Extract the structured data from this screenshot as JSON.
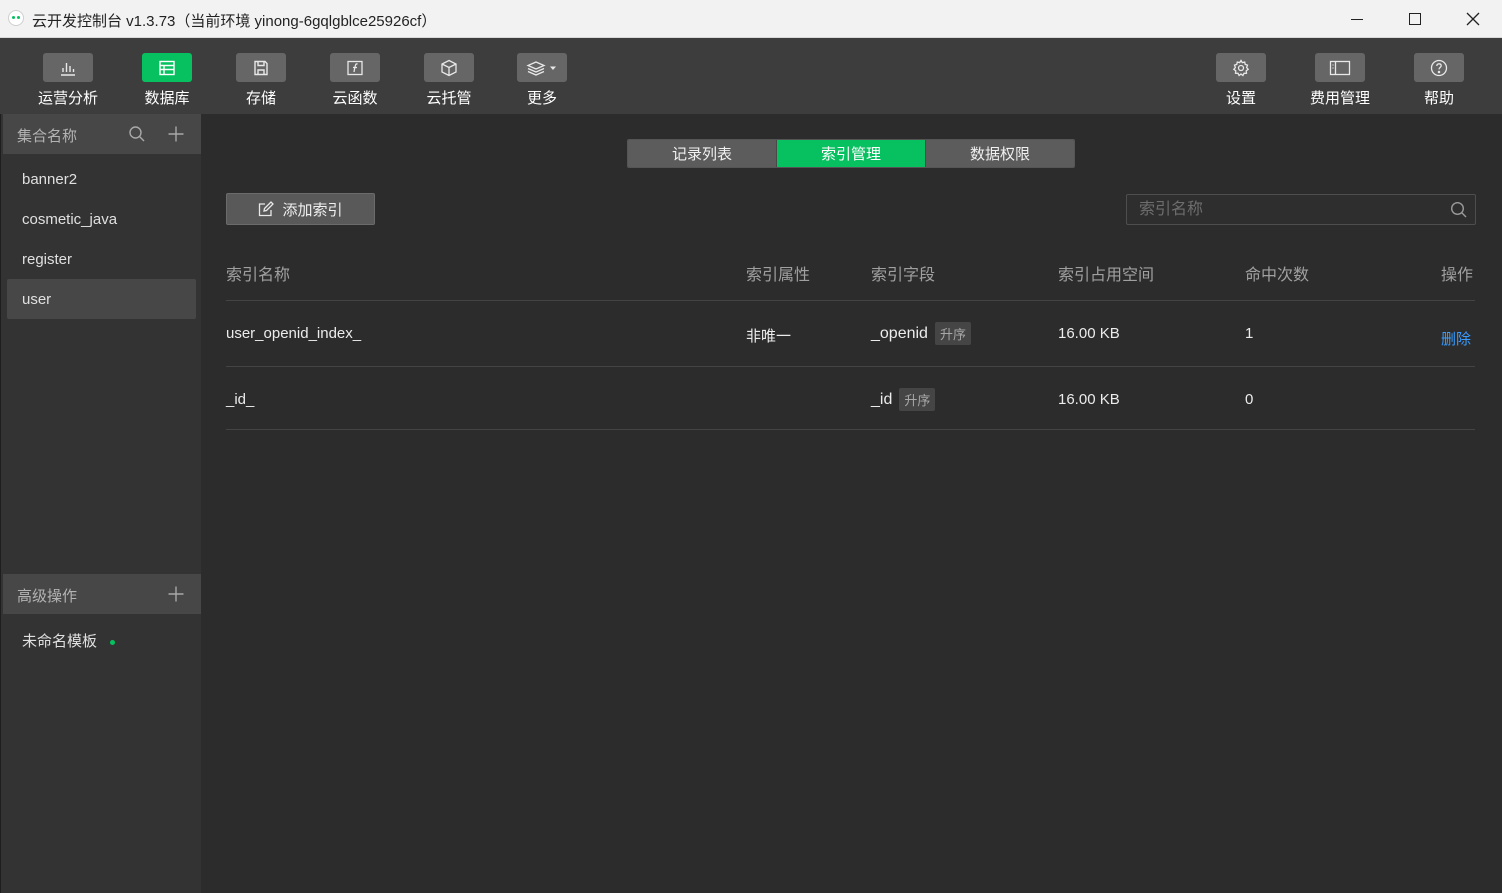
{
  "titlebar": {
    "title": "云开发控制台 v1.3.73（当前环境 yinong-6gqlgblce25926cf）"
  },
  "toolbar": {
    "left": [
      {
        "label": "运营分析",
        "icon": "bar-chart-icon"
      },
      {
        "label": "数据库",
        "icon": "database-icon",
        "active": true
      },
      {
        "label": "存储",
        "icon": "save-icon"
      },
      {
        "label": "云函数",
        "icon": "function-icon"
      },
      {
        "label": "云托管",
        "icon": "box-icon"
      },
      {
        "label": "更多",
        "icon": "layers-dropdown-icon"
      }
    ],
    "right": [
      {
        "label": "设置",
        "icon": "gear-icon"
      },
      {
        "label": "费用管理",
        "icon": "billing-icon"
      },
      {
        "label": "帮助",
        "icon": "help-icon"
      }
    ]
  },
  "sidebar": {
    "collections_header": "集合名称",
    "collections": [
      "banner2",
      "cosmetic_java",
      "register",
      "user"
    ],
    "active_collection": "user",
    "advanced_header": "高级操作",
    "templates": [
      "未命名模板"
    ]
  },
  "main": {
    "tabs": [
      "记录列表",
      "索引管理",
      "数据权限"
    ],
    "active_tab": "索引管理",
    "add_button": "添加索引",
    "search_placeholder": "索引名称",
    "columns": [
      "索引名称",
      "索引属性",
      "索引字段",
      "索引占用空间",
      "命中次数",
      "操作"
    ],
    "rows": [
      {
        "name": "user_openid_index_",
        "attribute": "非唯一",
        "field": "_openid",
        "order": "升序",
        "size": "16.00 KB",
        "hits": "1",
        "action": "删除"
      },
      {
        "name": "_id_",
        "attribute": "",
        "field": "_id",
        "order": "升序",
        "size": "16.00 KB",
        "hits": "0",
        "action": ""
      }
    ]
  },
  "colors": {
    "accent": "#07c160",
    "link": "#3a9cff",
    "toolbar_bg": "#3d3d3d",
    "main_bg": "#2c2c2c"
  }
}
